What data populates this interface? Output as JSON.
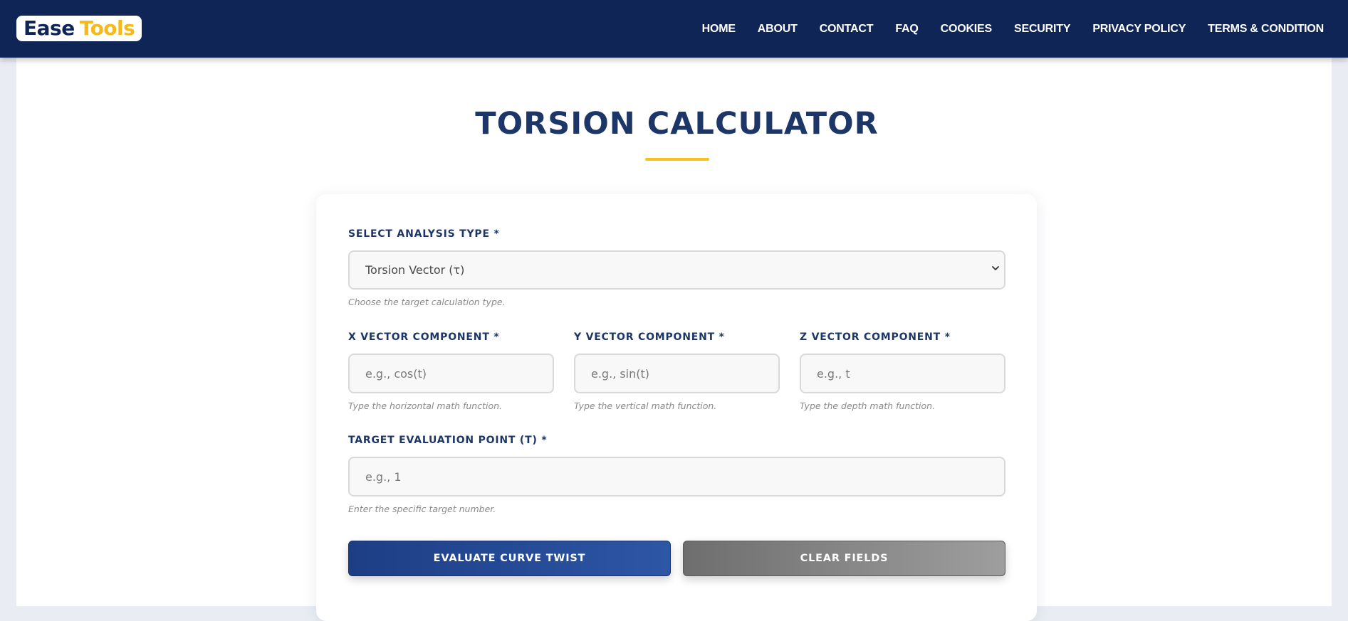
{
  "brand": {
    "word1": "Ease",
    "word2": "Tools",
    "navy": "#0f2556",
    "accent": "#f6b91a"
  },
  "nav": {
    "items": [
      "HOME",
      "ABOUT",
      "CONTACT",
      "FAQ",
      "COOKIES",
      "SECURITY",
      "PRIVACY POLICY",
      "TERMS & CONDITION"
    ]
  },
  "page": {
    "title": "TORSION CALCULATOR"
  },
  "form": {
    "analysis": {
      "label": "SELECT ANALYSIS TYPE *",
      "selected": "Torsion Vector (τ)",
      "hint": "Choose the target calculation type."
    },
    "x": {
      "label": "X VECTOR COMPONENT *",
      "placeholder": "e.g., cos(t)",
      "hint": "Type the horizontal math function."
    },
    "y": {
      "label": "Y VECTOR COMPONENT *",
      "placeholder": "e.g., sin(t)",
      "hint": "Type the vertical math function."
    },
    "z": {
      "label": "Z VECTOR COMPONENT *",
      "placeholder": "e.g., t",
      "hint": "Type the depth math function."
    },
    "t": {
      "label": "TARGET EVALUATION POINT (T) *",
      "placeholder": "e.g., 1",
      "hint": "Enter the specific target number."
    },
    "evaluate_label": "EVALUATE CURVE TWIST",
    "clear_label": "CLEAR FIELDS"
  },
  "icons": {
    "select_arrow": "chevron-down-icon"
  }
}
